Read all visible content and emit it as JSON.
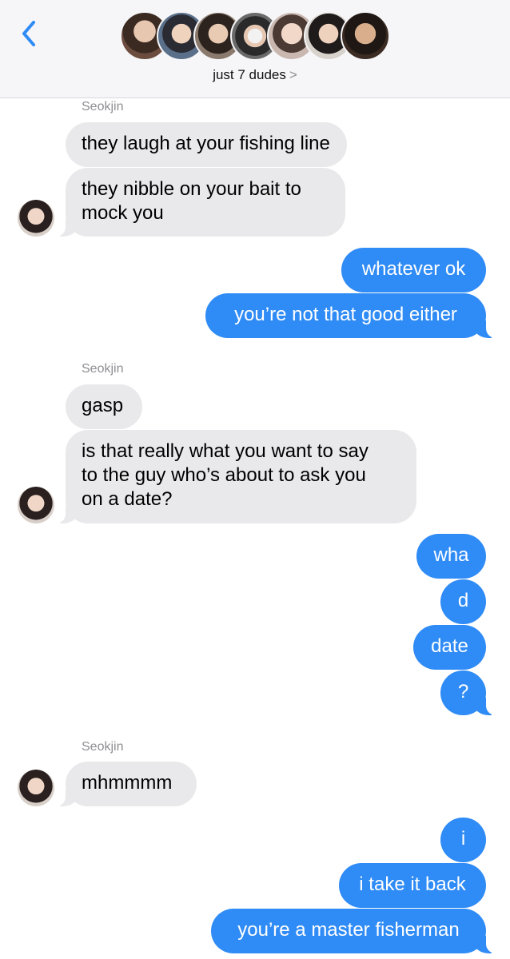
{
  "header": {
    "back_icon": "chevron-left-icon",
    "group_name": "just 7 dudes",
    "group_chevron": ">",
    "avatar_count": 7,
    "accent": "#2f8bf5"
  },
  "messages": {
    "sender_1": "Seokjin",
    "m1": "they laugh at your fishing line",
    "m2": "they nibble on your bait to\nmock you",
    "m3": "whatever ok",
    "m4": "you’re not that good either",
    "sender_2": "Seokjin",
    "m5": "gasp",
    "m6": "is that really what you want to say\nto the guy who’s about to ask you\non a date?",
    "m7": "wha",
    "m8": "d",
    "m9": "date",
    "m10": "?",
    "sender_3": "Seokjin",
    "m11": "mhmmmm",
    "m12": "i",
    "m13": "i take it back",
    "m14": "you’re a master fisherman"
  },
  "colors": {
    "incoming_bubble": "#e9e9eb",
    "outgoing_bubble": "#2f8bf5",
    "sender_label": "#8e8e93"
  }
}
